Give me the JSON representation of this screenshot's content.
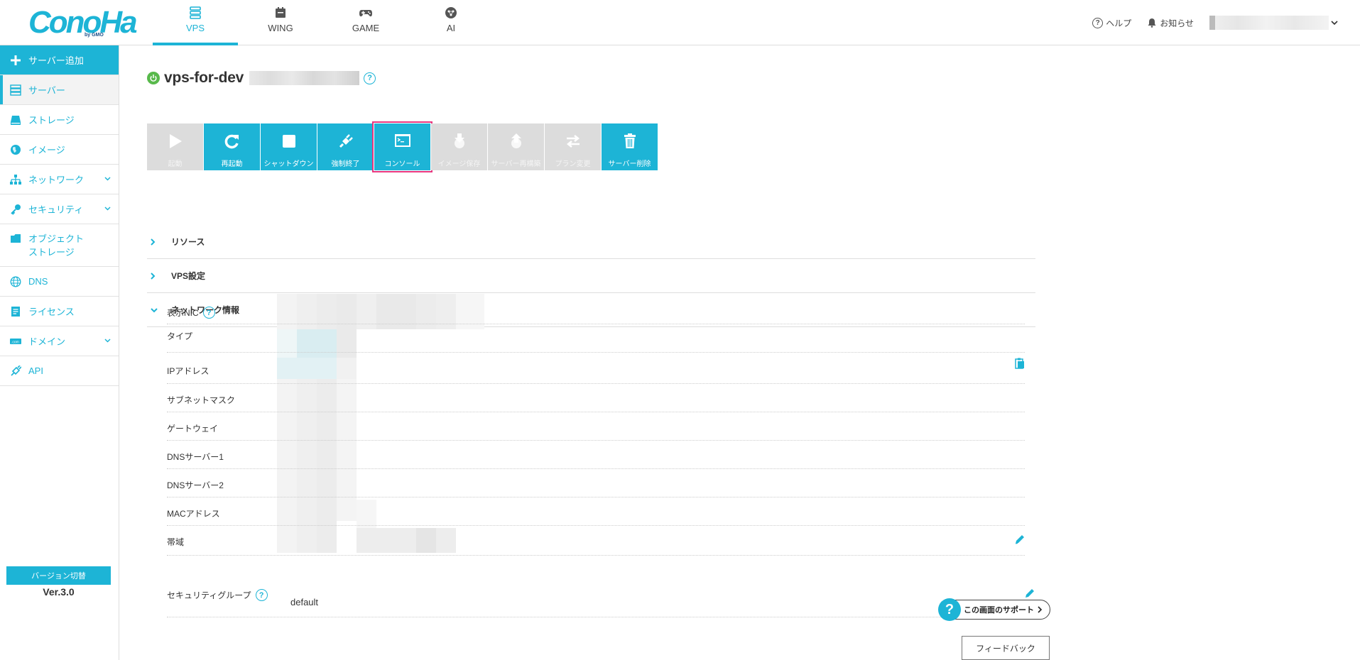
{
  "header": {
    "logo_text": "ConoHa",
    "logo_by": "by GMO",
    "tabs": [
      {
        "label": "VPS",
        "icon": "server-stack-icon",
        "active": true
      },
      {
        "label": "WING",
        "icon": "wing-icon",
        "active": false
      },
      {
        "label": "GAME",
        "icon": "gamepad-icon",
        "active": false
      },
      {
        "label": "AI",
        "icon": "ai-chip-icon",
        "active": false
      }
    ],
    "help_label": "ヘルプ",
    "notice_label": "お知らせ"
  },
  "sidebar": {
    "add_label": "サーバー追加",
    "items": [
      {
        "label": "サーバー",
        "icon": "server-icon"
      },
      {
        "label": "ストレージ",
        "icon": "storage-icon"
      },
      {
        "label": "イメージ",
        "icon": "globe-image-icon"
      },
      {
        "label": "ネットワーク",
        "icon": "network-icon"
      },
      {
        "label": "セキュリティ",
        "icon": "key-icon"
      },
      {
        "label": "オブジェクト\nストレージ",
        "icon": "folder-icon"
      },
      {
        "label": "DNS",
        "icon": "globe-icon"
      },
      {
        "label": "ライセンス",
        "icon": "license-icon"
      },
      {
        "label": "ドメイン",
        "icon": "domain-icon"
      },
      {
        "label": "API",
        "icon": "api-icon"
      }
    ],
    "version_button": "バージョン切替",
    "version_label": "Ver.3.0"
  },
  "server": {
    "name": "vps-for-dev",
    "status_color": "#58b94b"
  },
  "toolbar": {
    "buttons": [
      {
        "label": "起動",
        "icon": "play-icon",
        "enabled": false
      },
      {
        "label": "再起動",
        "icon": "restart-icon",
        "enabled": true
      },
      {
        "label": "シャットダウン",
        "icon": "stop-icon",
        "enabled": true
      },
      {
        "label": "強制終了",
        "icon": "plug-icon",
        "enabled": true
      },
      {
        "label": "コンソール",
        "icon": "console-icon",
        "enabled": true,
        "selected": true
      },
      {
        "label": "イメージ保存",
        "icon": "image-save-icon",
        "enabled": false
      },
      {
        "label": "サーバー再構築",
        "icon": "rebuild-icon",
        "enabled": false
      },
      {
        "label": "プラン変更",
        "icon": "plan-change-icon",
        "enabled": false
      },
      {
        "label": "サーバー削除",
        "icon": "trash-icon",
        "enabled": true
      }
    ]
  },
  "sections": {
    "resource": "リソース",
    "vps_settings": "VPS設定",
    "network_info": "ネットワーク情報"
  },
  "network": {
    "rows": [
      "表示NIC",
      "タイプ",
      "IPアドレス",
      "サブネットマスク",
      "ゲートウェイ",
      "DNSサーバー1",
      "DNSサーバー2",
      "MACアドレス",
      "帯域"
    ],
    "security_group_label": "セキュリティグループ",
    "security_group_value": "default"
  },
  "support": {
    "label": "この画面のサポート",
    "feedback": "フィードバック"
  },
  "colors": {
    "accent": "#1db4d6",
    "selected_outline": "#e8377f",
    "disabled": "#dcdcdc"
  }
}
